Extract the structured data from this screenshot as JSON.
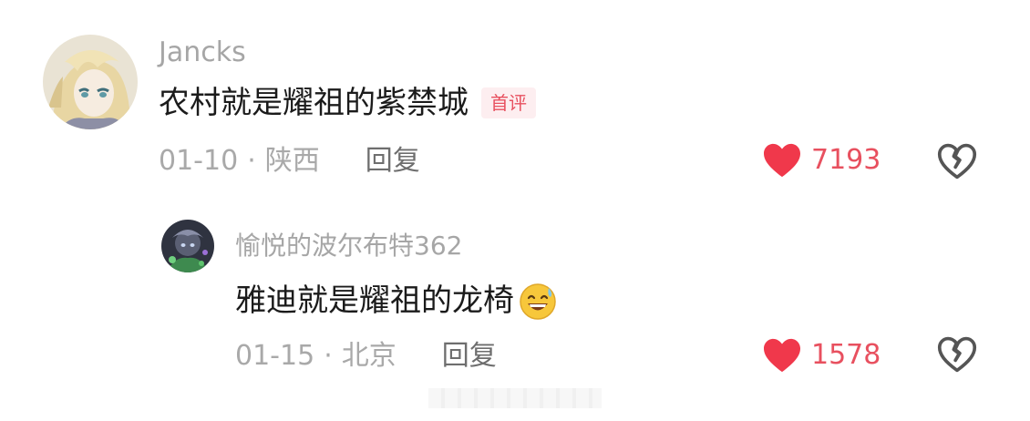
{
  "comments": [
    {
      "username": "Jancks",
      "text": "农村就是耀祖的紫禁城",
      "badge": "首评",
      "date": "01-10",
      "location": "陕西",
      "reply_label": "回复",
      "likes": "7193",
      "avatar_icon": "anime-avatar-blonde"
    }
  ],
  "replies": [
    {
      "username": "愉悦的波尔布特362",
      "text": "雅迪就是耀祖的龙椅",
      "emoji": "grinning-sweat-emoji",
      "date": "01-15",
      "location": "北京",
      "reply_label": "回复",
      "likes": "1578",
      "avatar_icon": "anime-avatar-dark"
    }
  ],
  "meta_separator": "·",
  "colors": {
    "like_red": "#f0384b",
    "badge_bg": "#fdeef0",
    "badge_text": "#e8505f",
    "muted_text": "#a9a9a9"
  }
}
